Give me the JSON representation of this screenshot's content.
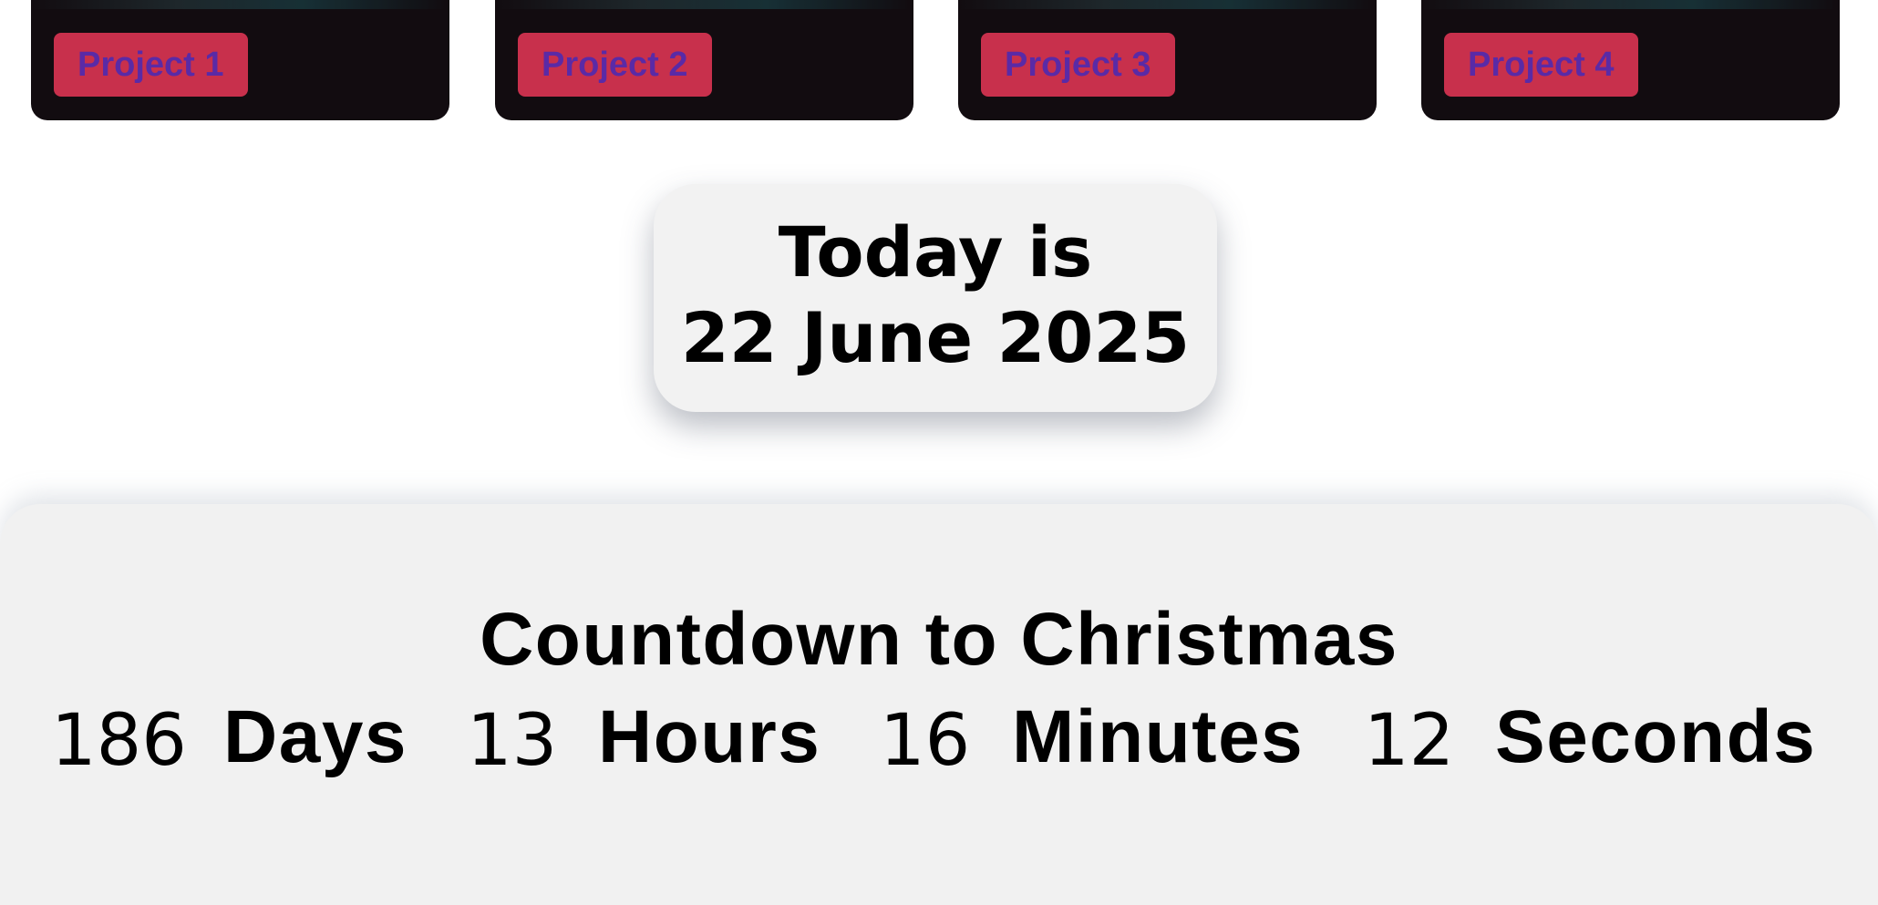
{
  "projects": [
    {
      "label": "Project 1"
    },
    {
      "label": "Project 2"
    },
    {
      "label": "Project 3"
    },
    {
      "label": "Project 4"
    }
  ],
  "today": {
    "prefix": "Today is",
    "date": "22 June 2025"
  },
  "countdown": {
    "title": "Countdown to Christmas",
    "days": {
      "value": "186",
      "unit": "Days"
    },
    "hours": {
      "value": "13",
      "unit": "Hours"
    },
    "minutes": {
      "value": "16",
      "unit": "Minutes"
    },
    "seconds": {
      "value": "12",
      "unit": "Seconds"
    }
  },
  "colors": {
    "card_background": "#120c10",
    "badge_background": "#c8304c",
    "badge_text": "#5a2aa6",
    "panel_background": "#f1f1f1",
    "today_card_background": "#f2f2f2"
  }
}
